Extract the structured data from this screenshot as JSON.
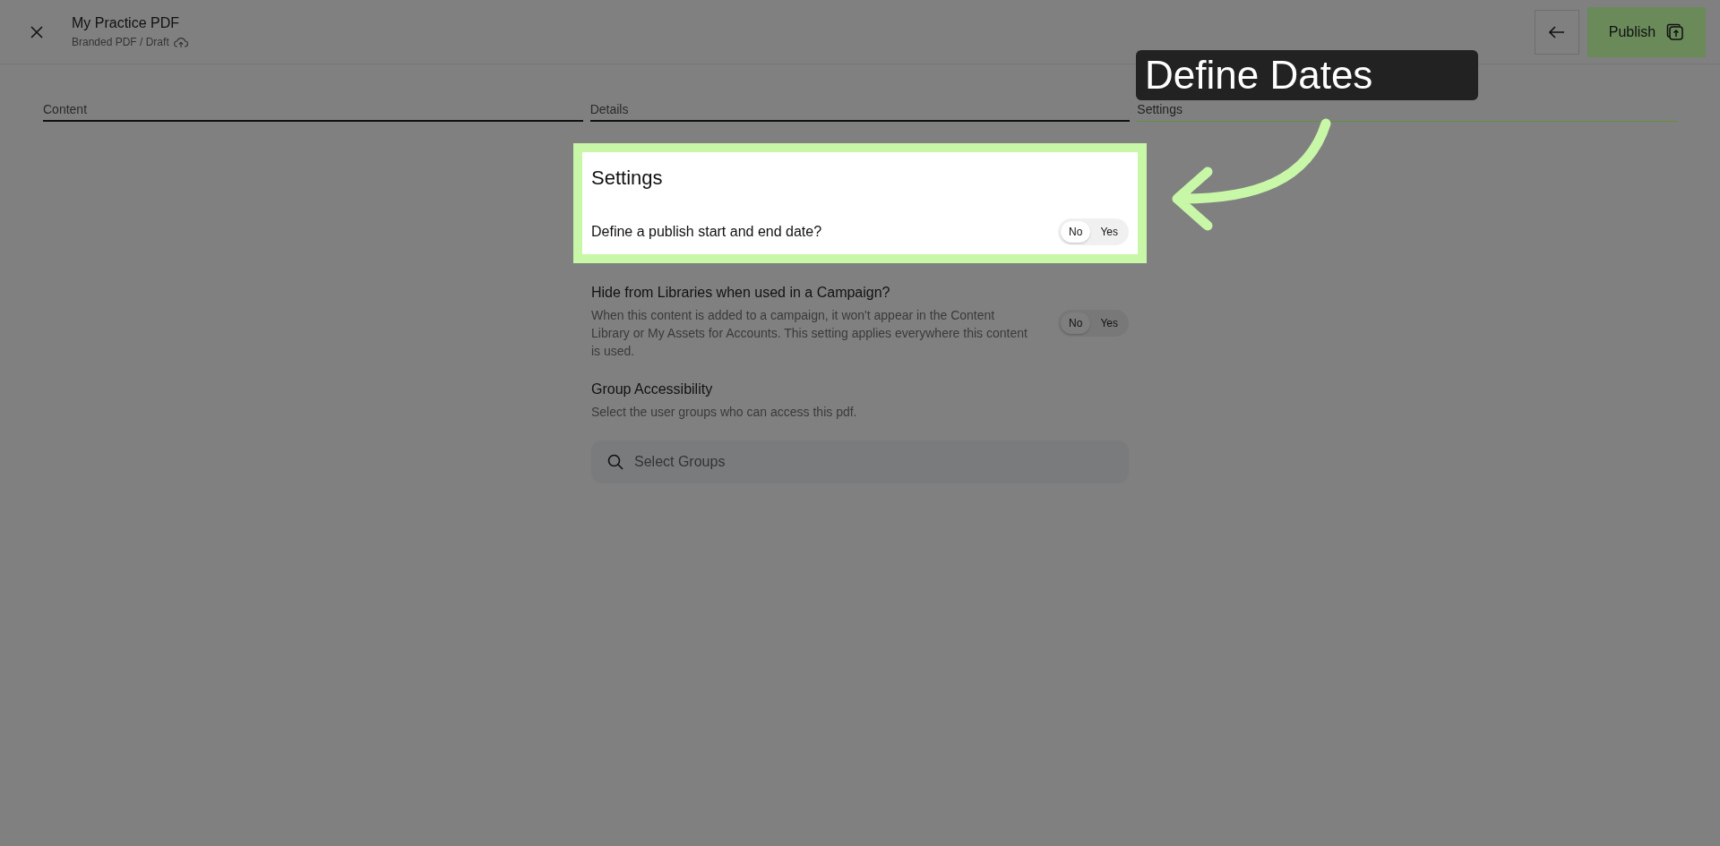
{
  "header": {
    "title": "My Practice PDF",
    "breadcrumb": "Branded PDF / Draft",
    "publish_label": "Publish"
  },
  "tabs": [
    {
      "label": "Content",
      "selected": false
    },
    {
      "label": "Details",
      "selected": false
    },
    {
      "label": "Settings",
      "selected": true
    }
  ],
  "settings": {
    "title": "Settings",
    "items": [
      {
        "kind": "toggle",
        "label": "Define a publish start and end date?",
        "options": [
          {
            "label": "No",
            "selected": true
          },
          {
            "label": "Yes",
            "selected": false
          }
        ]
      },
      {
        "kind": "toggle",
        "label": "Hide from Libraries when used in a Campaign?",
        "description": "When this content is added to a campaign, it won't appear in the Content Library or My Assets for Accounts. This setting applies everywhere this content is used.",
        "options": [
          {
            "label": "No",
            "selected": true
          },
          {
            "label": "Yes",
            "selected": false
          }
        ]
      },
      {
        "kind": "search",
        "label": "Group Accessibility",
        "description": "Select the user groups who can access this pdf.",
        "placeholder": "Select Groups"
      }
    ]
  },
  "callout": {
    "text": "Define Dates"
  }
}
